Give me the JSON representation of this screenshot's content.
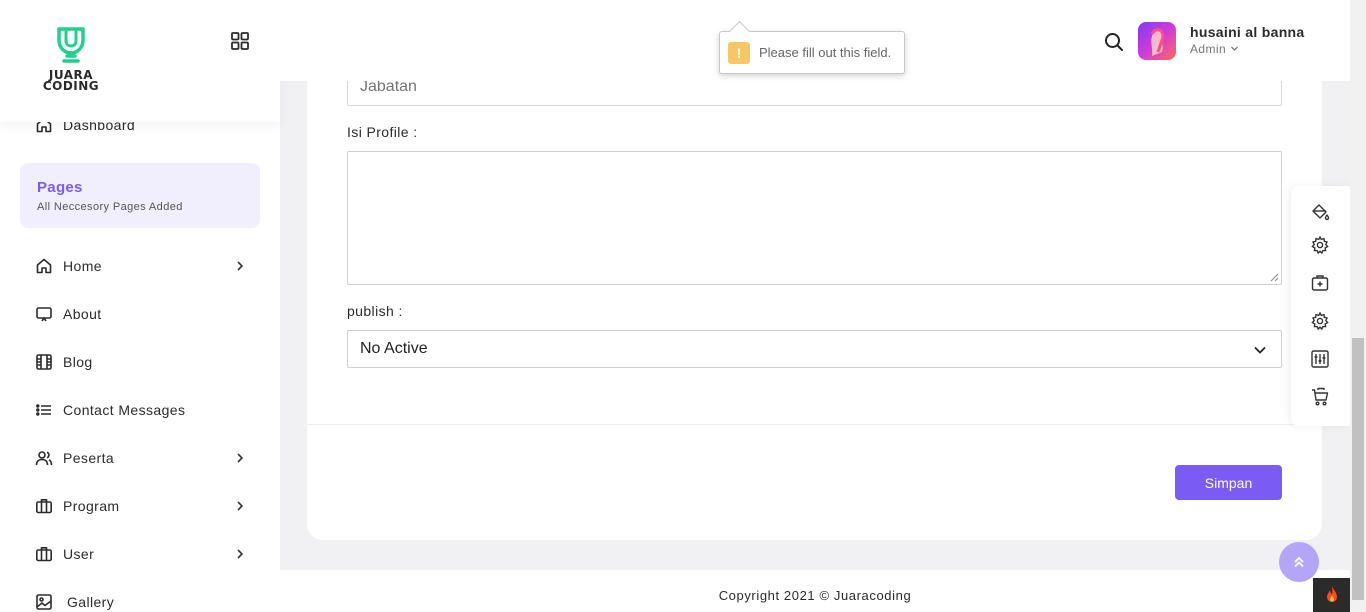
{
  "brand": {
    "line1": "JUARA",
    "line2": "CODING",
    "color": "#1fd18a"
  },
  "sidebar": {
    "top_item": {
      "label": "Dashboard",
      "icon": "home-icon"
    },
    "pages_card": {
      "title": "Pages",
      "subtitle": "All Neccesory Pages Added"
    },
    "items": [
      {
        "label": "Home",
        "icon": "home-icon",
        "has_submenu": true
      },
      {
        "label": "About",
        "icon": "monitor-icon",
        "has_submenu": false
      },
      {
        "label": "Blog",
        "icon": "film-icon",
        "has_submenu": false
      },
      {
        "label": "Contact Messages",
        "icon": "list-icon",
        "has_submenu": false
      },
      {
        "label": "Peserta",
        "icon": "users-icon",
        "has_submenu": true
      },
      {
        "label": "Program",
        "icon": "briefcase-icon",
        "has_submenu": true
      },
      {
        "label": "User",
        "icon": "briefcase-icon",
        "has_submenu": true
      },
      {
        "label": "Gallery",
        "icon": "image-icon",
        "has_submenu": false
      }
    ]
  },
  "header": {
    "user": {
      "name": "husaini al banna",
      "role": "Admin"
    }
  },
  "tooltip": {
    "text": "Please fill out this field."
  },
  "form": {
    "jabatan": {
      "placeholder": "Jabatan",
      "value": ""
    },
    "isi_profile": {
      "label": "Isi Profile :",
      "value": ""
    },
    "publish": {
      "label": "publish :",
      "selected": "No Active"
    },
    "submit_label": "Simpan"
  },
  "footer": {
    "copyright": "Copyright 2021 © Juaracoding"
  },
  "colors": {
    "accent": "#7a5cf4",
    "accent_light": "#f1eefd",
    "warning": "#f7c765"
  },
  "tools": [
    "paint-bucket-icon",
    "gear-icon",
    "briefcase-plus-icon",
    "gear-icon",
    "sliders-icon",
    "cart-icon"
  ]
}
